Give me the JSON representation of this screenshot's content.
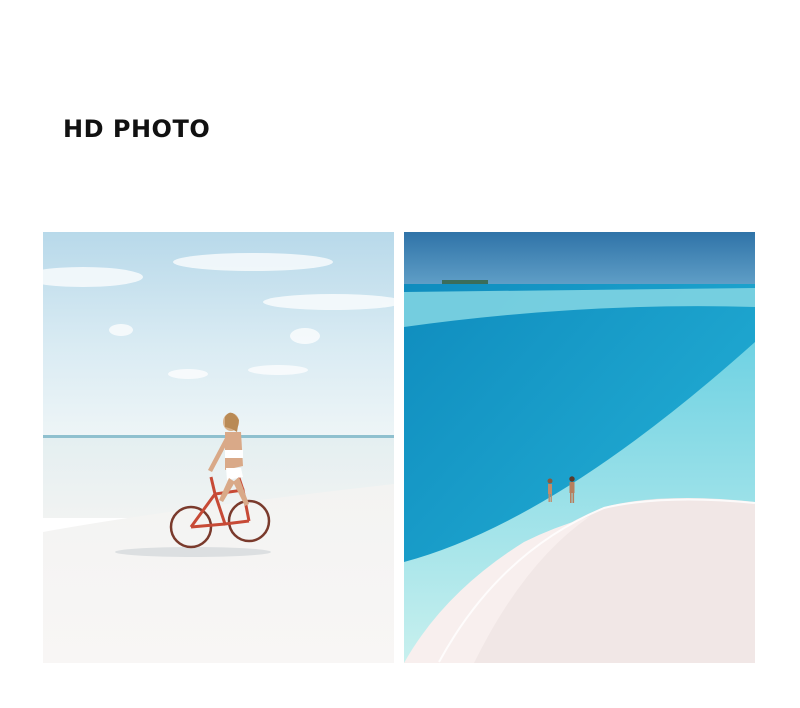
{
  "header": {
    "title": "HD PHOTO"
  },
  "photos": [
    {
      "subject": "woman-riding-bicycle-on-beach"
    },
    {
      "subject": "couple-walking-on-sandbar"
    }
  ],
  "colors": {
    "background": "#ffffff",
    "title": "#111111",
    "sky": "#d4e8f2",
    "sand": "#f6f4f3",
    "lagoon": "#2aa6cc",
    "shallow": "#8fe0e3"
  }
}
